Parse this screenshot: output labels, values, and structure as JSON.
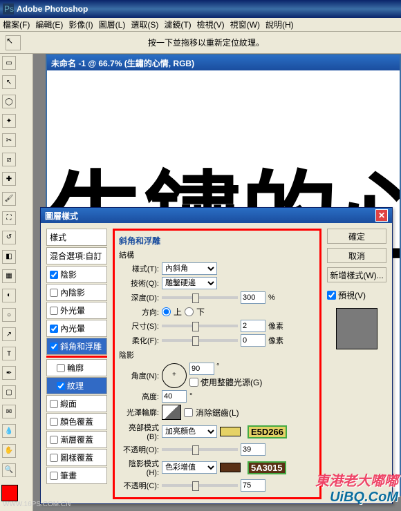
{
  "app": {
    "title": "Adobe Photoshop"
  },
  "menu": [
    "檔案(F)",
    "編輯(E)",
    "影像(I)",
    "圖層(L)",
    "選取(S)",
    "濾鏡(T)",
    "檢視(V)",
    "視窗(W)",
    "說明(H)"
  ],
  "options_hint": "按一下並拖移以重新定位紋理。",
  "doc": {
    "title": "未命名 -1 @ 66.7% (生鏽的心情, RGB)",
    "canvas_text": "生鏽的心情"
  },
  "dialog": {
    "title": "圖層樣式",
    "styles": {
      "header": "樣式",
      "blend": "混合選項:自訂",
      "items": [
        {
          "label": "陰影",
          "checked": true
        },
        {
          "label": "內陰影",
          "checked": false
        },
        {
          "label": "外光暈",
          "checked": false
        },
        {
          "label": "內光暈",
          "checked": true
        },
        {
          "label": "斜角和浮雕",
          "checked": true,
          "selected": true
        },
        {
          "label": "輪廓",
          "checked": false,
          "indent": true
        },
        {
          "label": "紋理",
          "checked": true,
          "indent": true,
          "highlighted": true
        },
        {
          "label": "緞面",
          "checked": false
        },
        {
          "label": "顏色覆蓋",
          "checked": false
        },
        {
          "label": "漸層覆蓋",
          "checked": false
        },
        {
          "label": "圖樣覆蓋",
          "checked": false
        },
        {
          "label": "筆畫",
          "checked": false
        }
      ]
    },
    "bevel": {
      "section": "斜角和浮雕",
      "structure_label": "結構",
      "style_label": "樣式(T):",
      "style_value": "內斜角",
      "technique_label": "技術(Q):",
      "technique_value": "雕鑿硬邊",
      "depth_label": "深度(D):",
      "depth_value": "300",
      "depth_unit": "%",
      "direction_label": "方向:",
      "direction_up": "上",
      "direction_down": "下",
      "size_label": "尺寸(S):",
      "size_value": "2",
      "size_unit": "像素",
      "soften_label": "柔化(F):",
      "soften_value": "0",
      "soften_unit": "像素",
      "shading_label": "陰影",
      "angle_label": "角度(N):",
      "angle_value": "90",
      "angle_deg": "°",
      "global_label": "使用整體光源(G)",
      "altitude_label": "高度:",
      "altitude_value": "40",
      "altitude_deg": "°",
      "gloss_label": "光澤輪廓:",
      "antialias_label": "消除鋸齒(L)",
      "highlight_mode_label": "亮部模式(B):",
      "highlight_mode_value": "加亮顏色",
      "highlight_hex": "E5D266",
      "highlight_opacity_label": "不透明(O):",
      "highlight_opacity_value": "39",
      "shadow_mode_label": "陰影模式(H):",
      "shadow_mode_value": "色彩增值",
      "shadow_hex": "5A3015",
      "shadow_opacity_label": "不透明(C):",
      "shadow_opacity_value": "75"
    },
    "buttons": {
      "ok": "確定",
      "cancel": "取消",
      "new_style": "新增樣式(W)...",
      "preview": "預視(V)"
    }
  },
  "watermark": {
    "line1": "東港老大嘟嘟",
    "line2": "UiBQ.CoM"
  },
  "footer_url": "WWW.16PS.COM.CN"
}
